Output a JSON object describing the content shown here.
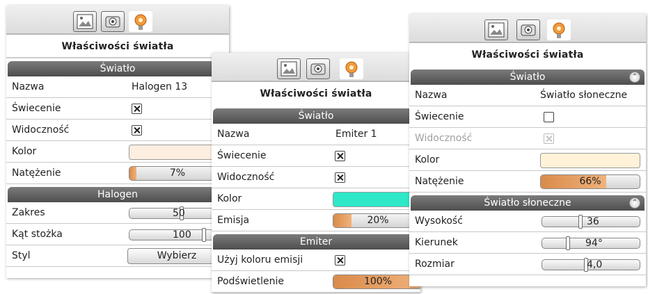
{
  "colors": {
    "accent_orange": "#e8a060",
    "header_gray": "#5e5e5e",
    "emission_cyan": "#2ee8c8",
    "halogen_color": "#fdeee0",
    "sun_color": "#fff2d8"
  },
  "icons": [
    "landscape-icon",
    "camera-icon",
    "light-bulb-icon"
  ],
  "panel1": {
    "title": "Właściwości światła",
    "section_light": "Światło",
    "rows": [
      {
        "label": "Nazwa",
        "value": "Halogen 13"
      },
      {
        "label": "Świecenie",
        "checked": true
      },
      {
        "label": "Widoczność",
        "checked": true
      },
      {
        "label": "Kolor"
      },
      {
        "label": "Natężenie",
        "value": "7%",
        "fraction": 0.07
      }
    ],
    "section_halogen": "Halogen",
    "halogen_rows": [
      {
        "label": "Zakres",
        "value": "50"
      },
      {
        "label": "Kąt stożka",
        "value": "100"
      },
      {
        "label": "Styl",
        "button": "Wybierz"
      }
    ]
  },
  "panel2": {
    "title": "Właściwości światła",
    "section_light": "Światło",
    "rows": [
      {
        "label": "Nazwa",
        "value": "Emiter 1"
      },
      {
        "label": "Świecenie",
        "checked": true
      },
      {
        "label": "Widoczność",
        "checked": true
      },
      {
        "label": "Kolor"
      },
      {
        "label": "Emisja",
        "value": "20%",
        "fraction": 0.2
      }
    ],
    "section_emitter": "Emiter",
    "emitter_rows": [
      {
        "label": "Użyj koloru emisji",
        "checked": true
      },
      {
        "label": "Podświetlenie",
        "value": "100%",
        "fraction": 1.0
      }
    ]
  },
  "panel3": {
    "title": "Właściwości światła",
    "section_light": "Światło",
    "rows": [
      {
        "label": "Nazwa",
        "value": "Światło słoneczne"
      },
      {
        "label": "Świecenie",
        "checked": false
      },
      {
        "label": "Widoczność",
        "checked": true,
        "disabled": true
      },
      {
        "label": "Kolor"
      },
      {
        "label": "Natężenie",
        "value": "66%",
        "fraction": 0.66
      }
    ],
    "section_sun": "Światło słoneczne",
    "sun_rows": [
      {
        "label": "Wysokość",
        "value": "36"
      },
      {
        "label": "Kierunek",
        "value": "94°"
      },
      {
        "label": "Rozmiar",
        "value": "4,0"
      }
    ]
  }
}
